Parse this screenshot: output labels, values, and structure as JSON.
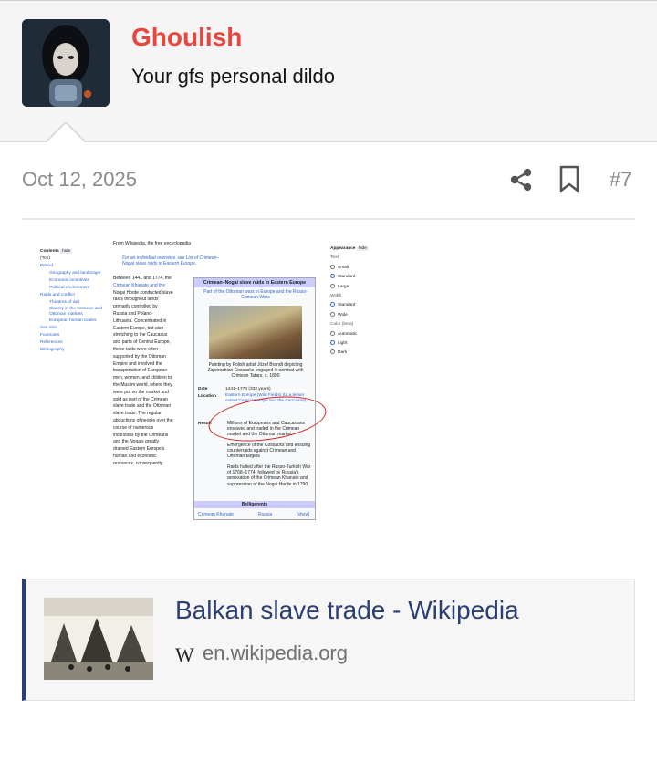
{
  "user": {
    "name": "Ghoulish",
    "title": "Your gfs personal dildo",
    "name_color": "#e8453c"
  },
  "post": {
    "date": "Oct 12, 2025",
    "number": "#7",
    "icons": [
      "share-icon",
      "bookmark-icon"
    ]
  },
  "screenshot": {
    "from_line": "From Wikipedia, the free encyclopedia",
    "hatnote": "For an individual overview, see List of Crimean–Nogai slave raids in Eastern Europe.",
    "toc": {
      "header": "Contents",
      "hide": "hide",
      "items": [
        "(Top)",
        "Period",
        "Geography and landscape",
        "Economic incentives",
        "Political environment",
        "Raids and conflict",
        "Theatres of war",
        "Slavery in the Crimean and Ottoman markets",
        "European human trades",
        "See also",
        "Footnotes",
        "References",
        "Bibliography"
      ]
    },
    "body_lines": [
      "Between 1441 and 1774, the",
      "Crimean Khanate and the",
      "Nogai Horde conducted slave",
      "raids throughout lands",
      "primarily controlled by",
      "Russia and Poland-",
      "Lithuania. Concentrated in",
      "Eastern Europe, but also",
      "stretching to the Caucasus",
      "and parts of Central Europe,",
      "these raids were often",
      "supported by the Ottoman",
      "Empire and involved the",
      "transportation of European",
      "men, women, and children to",
      "the Muslim world, where they",
      "were put on the market and",
      "sold as part of the Crimean",
      "slave trade and the Ottoman",
      "slave trade. The regular",
      "abductions of people over the",
      "course of numerous",
      "incursions by the Crimeans",
      "and the Nogais greatly",
      "drained Eastern Europe's",
      "human and economic",
      "resources, consequently"
    ],
    "infobox": {
      "title": "Crimean–Nogai slave raids in Eastern Europe",
      "subtitle": "Part of the Ottoman wars in Europe and the Russo-Crimean Wars",
      "caption": "Painting by Polish artist Józef Brandt depicting Zaporozhian Cossacks engaged in combat with Crimean Tatars, c. 1890",
      "date_label": "Date",
      "date_value": "1441–1774 (333 years)",
      "location_label": "Location",
      "location_value": "Eastern Europe (Wild Fields) (to a lesser extent Central Europe and the Caucasus)",
      "result_label": "Result",
      "result_items": [
        "Millions of Europeans and Caucasians enslaved and traded in the Crimean market and the Ottoman market",
        "Emergence of the Cossacks and ensuing counterraids against Crimean and Ottoman targets",
        "Raids halted after the Russo-Turkish War of 1768–1774, followed by Russia's annexation of the Crimean Khanate and suppression of the Nogai Horde in 1790"
      ],
      "belligerents": "Belligerents",
      "bell_left": "Crimean Khanate",
      "bell_right": "Russia",
      "bell_show": "[show]"
    },
    "appearance": {
      "header": "Appearance",
      "hide": "hide",
      "text_label": "Text",
      "text_options": [
        "Small",
        "Standard",
        "Large"
      ],
      "width_label": "Width",
      "width_options": [
        "Standard",
        "Wide"
      ],
      "color_label": "Color (beta)",
      "color_options": [
        "Automatic",
        "Light",
        "Dark"
      ]
    }
  },
  "link_card": {
    "title": "Balkan slave trade - Wikipedia",
    "favicon": "W",
    "domain": "en.wikipedia.org",
    "accent": "#2b3f74"
  }
}
